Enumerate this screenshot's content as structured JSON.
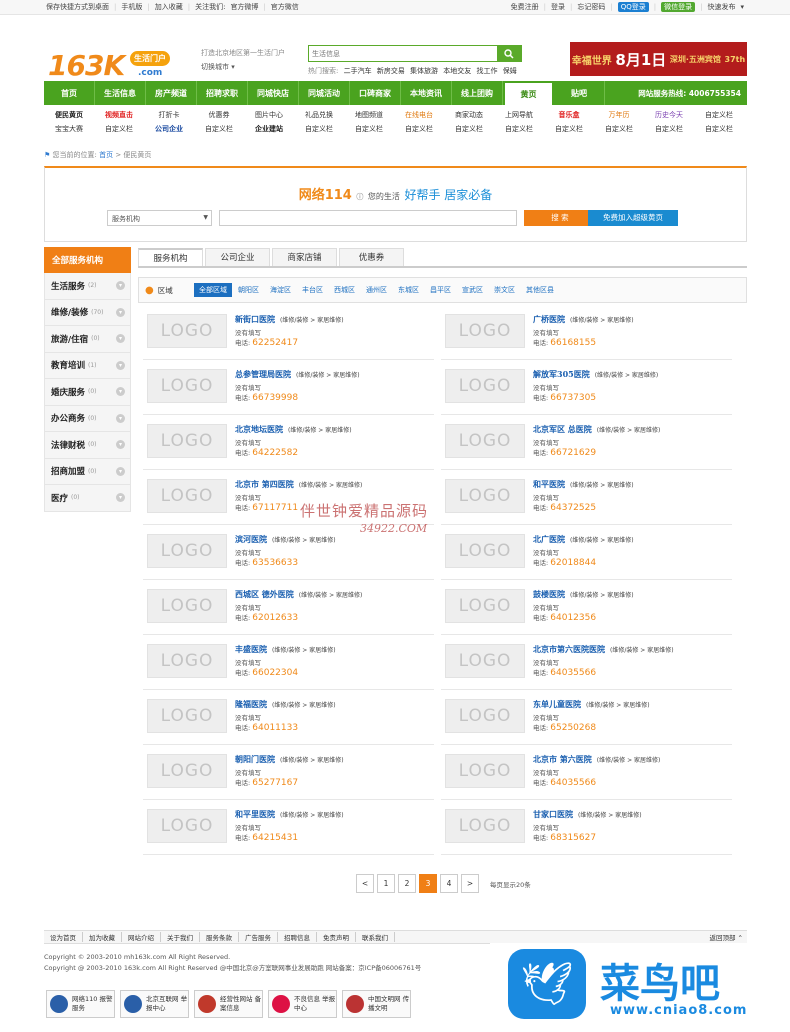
{
  "topbar": {
    "left": [
      "保存快捷方式到桌面",
      "手机版",
      "加入收藏",
      "关注我们:",
      "官方微博",
      "官方微信"
    ],
    "right": [
      "免费注册",
      "登录",
      "忘记密码",
      "QQ登录",
      "微信登录",
      "快速发布"
    ]
  },
  "header": {
    "logo_main": "163K",
    "logo_pill": "生活门户",
    "logo_dom": ".com",
    "slogan": "打造北京地区第一生活门户",
    "city_switch": "切换城市 ▾",
    "search_placeholder": "生活信息",
    "hot_label": "热门搜索:",
    "hot_terms": [
      "二手汽车",
      "新房交易",
      "集体旅游",
      "本地交友",
      "找工作",
      "保姆"
    ],
    "banner": {
      "brand": "幸福世界",
      "date": "8月1日",
      "place": "深圳·五洲宾馆",
      "issue": "37th"
    }
  },
  "nav": {
    "items": [
      "首页",
      "生活信息",
      "房产频道",
      "招聘求职",
      "同城快店",
      "同城活动",
      "口碑商家",
      "本地资讯",
      "线上团购",
      "黄页",
      "贴吧"
    ],
    "hotline": "网站服务热线: 4006755354"
  },
  "subnav": {
    "row1": [
      "便民黄页",
      "视频直击",
      "打折卡",
      "优惠券",
      "图片中心",
      "礼品兑换",
      "地图频道",
      "在线电台",
      "商家动态",
      "上网导航",
      "音乐盒",
      "万年历",
      "历史今天",
      "自定义栏"
    ],
    "row2": [
      "宝宝大赛",
      "自定义栏",
      "公司企业",
      "自定义栏",
      "企业建站",
      "自定义栏",
      "自定义栏",
      "自定义栏",
      "自定义栏",
      "自定义栏",
      "自定义栏",
      "自定义栏",
      "自定义栏",
      "自定义栏"
    ]
  },
  "breadcrumb": {
    "prefix": "您当前的位置:",
    "home": "首页",
    "current": "> 便民黄页"
  },
  "search_box": {
    "title": "网络114",
    "subtitle": "您的生活",
    "emphasis": "好帮手 居家必备",
    "select_value": "服务机构",
    "search_btn": "搜 索",
    "join_btn": "免费加入超级黄页"
  },
  "sidebar": {
    "head": "全部服务机构",
    "items": [
      {
        "label": "生活服务",
        "count": "(2)"
      },
      {
        "label": "维修/装修",
        "count": "(70)"
      },
      {
        "label": "旅游/住宿",
        "count": "(0)"
      },
      {
        "label": "教育培训",
        "count": "(1)"
      },
      {
        "label": "婚庆服务",
        "count": "(0)"
      },
      {
        "label": "办公商务",
        "count": "(0)"
      },
      {
        "label": "法律财税",
        "count": "(0)"
      },
      {
        "label": "招商加盟",
        "count": "(0)"
      },
      {
        "label": "医疗",
        "count": "(0)"
      }
    ]
  },
  "tabs": [
    "服务机构",
    "公司企业",
    "商家店铺",
    "优惠券"
  ],
  "region": {
    "label": "区域",
    "items": [
      "全部区域",
      "朝阳区",
      "海淀区",
      "丰台区",
      "西城区",
      "通州区",
      "东城区",
      "昌平区",
      "宣武区",
      "崇文区",
      "其他区县"
    ]
  },
  "listing": {
    "logo_text": "LOGO",
    "category": "(维修/装修 > 家居维修)",
    "desc": "没有填写",
    "phone_label": "电话:",
    "items": [
      {
        "name": "新街口医院",
        "phone": "62252417"
      },
      {
        "name": "广桥医院",
        "phone": "66168155"
      },
      {
        "name": "总参管理局医院",
        "phone": "66739998"
      },
      {
        "name": "解放军305医院",
        "phone": "66737305"
      },
      {
        "name": "北京地坛医院",
        "phone": "64222582"
      },
      {
        "name": "北京军区 总医院",
        "phone": "66721629"
      },
      {
        "name": "北京市 第四医院",
        "phone": "67117711"
      },
      {
        "name": "和平医院",
        "phone": "64372525"
      },
      {
        "name": "滨河医院",
        "phone": "63536633"
      },
      {
        "name": "北广医院",
        "phone": "62018844"
      },
      {
        "name": "西城区 德外医院",
        "phone": "62012633"
      },
      {
        "name": "鼓楼医院",
        "phone": "64012356"
      },
      {
        "name": "丰盛医院",
        "phone": "66022304"
      },
      {
        "name": "北京市第六医院医院",
        "phone": "64035566"
      },
      {
        "name": "隆福医院",
        "phone": "64011133"
      },
      {
        "name": "东单儿童医院",
        "phone": "65250268"
      },
      {
        "name": "朝阳门医院",
        "phone": "65277167"
      },
      {
        "name": "北京市 第六医院",
        "phone": "64035566"
      },
      {
        "name": "和平里医院",
        "phone": "64215431"
      },
      {
        "name": "甘家口医院",
        "phone": "68315627"
      }
    ]
  },
  "pager": {
    "prev": "<",
    "pages": [
      "1",
      "2",
      "3",
      "4"
    ],
    "active": "3",
    "next": ">",
    "info": "每页显示20条"
  },
  "watermark": {
    "line1": "伴世钟爱精品源码",
    "line2": "34922.COM"
  },
  "footer": {
    "links": [
      "设为首页",
      "加为收藏",
      "网站介绍",
      "关于我们",
      "服务条款",
      "广告服务",
      "招聘信息",
      "免责声明",
      "联系我们"
    ],
    "totop": "返回顶部",
    "copy1": "Copyright © 2003-2010 mh163k.com All Right Reserved.",
    "copy2": "Copyright @ 2003-2010 163k.com All Right Reserved @中国北京@方室联网事业发展助跑 网站备案：京ICP备06006761号",
    "badges": [
      "网络110 报警服务",
      "北京互联网 举报中心",
      "经营性网站 备案信息",
      "不良信息 举报中心",
      "中国文明网 传播文明"
    ]
  },
  "corner_logo": {
    "name": "菜鸟吧",
    "url": "www.cniao8.com"
  }
}
